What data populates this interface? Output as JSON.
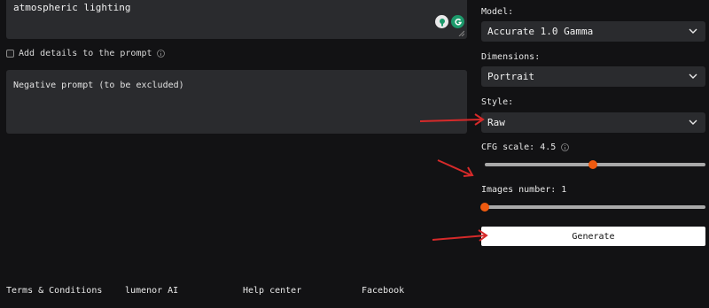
{
  "prompt": {
    "text": "atmospheric lighting"
  },
  "options": {
    "details_label": "Add details to the prompt",
    "details_checked": false
  },
  "negative_prompt": {
    "placeholder": "Negative prompt (to be excluded)"
  },
  "model": {
    "label": "Model:",
    "value": "Accurate 1.0 Gamma"
  },
  "dimensions": {
    "label": "Dimensions:",
    "value": "Portrait"
  },
  "style": {
    "label": "Style:",
    "value": "Raw"
  },
  "cfg": {
    "label": "CFG scale: 4.5",
    "value": 4.5
  },
  "images": {
    "label": "Images number: 1",
    "value": 1
  },
  "generate": {
    "label": "Generate"
  },
  "footer": {
    "links": [
      "Terms & Conditions",
      "lumenor AI",
      "Help center",
      "Facebook"
    ]
  },
  "colors": {
    "accent": "#ef5a0f",
    "annotation_arrow": "#d62a2a",
    "panel": "#2a2b2e",
    "background": "#121214"
  },
  "icons": [
    "info-icon",
    "chevron-down-icon",
    "grammarly-icon",
    "extension-icon",
    "resize-grip-icon",
    "annotation-arrow"
  ]
}
